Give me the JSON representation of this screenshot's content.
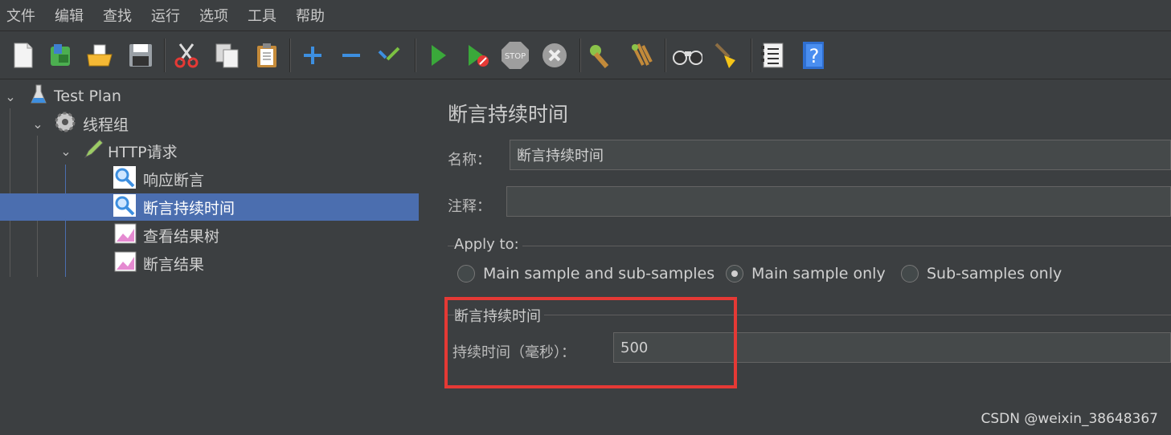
{
  "menu": [
    "文件",
    "编辑",
    "查找",
    "运行",
    "选项",
    "工具",
    "帮助"
  ],
  "toolbar_icons": [
    "new-icon",
    "templates-icon",
    "open-icon",
    "save-icon",
    "cut-icon",
    "copy-icon",
    "paste-icon",
    "expand-icon",
    "collapse-icon",
    "toggle-icon",
    "start-icon",
    "start-no-pause-icon",
    "stop-icon",
    "shutdown-icon",
    "clear-icon",
    "clear-all-icon",
    "search-icon",
    "reset-search-icon",
    "function-helper-icon",
    "help-icon"
  ],
  "tree": {
    "items": [
      {
        "label": "Test Plan",
        "icon": "test-plan-icon"
      },
      {
        "label": "线程组",
        "icon": "thread-group-gear-icon"
      },
      {
        "label": "HTTP请求",
        "icon": "http-sampler-pen-icon"
      },
      {
        "label": "响应断言",
        "icon": "assertion-magnifier-icon"
      },
      {
        "label": "断言持续时间",
        "icon": "assertion-magnifier-icon"
      },
      {
        "label": "查看结果树",
        "icon": "listener-chart-icon"
      },
      {
        "label": "断言结果",
        "icon": "listener-chart-icon"
      }
    ],
    "selected": "断言持续时间"
  },
  "panel": {
    "title": "断言持续时间",
    "name_label": "名称：",
    "name_value": "断言持续时间",
    "comment_label": "注释：",
    "comment_value": "",
    "apply_to": {
      "title": "Apply to:",
      "options": [
        "Main sample and sub-samples",
        "Main sample only",
        "Sub-samples only"
      ],
      "selected": "Main sample only"
    },
    "duration_group": {
      "title": "断言持续时间",
      "label": "持续时间（毫秒）：",
      "value": "500"
    }
  },
  "highlight_color": "#e53935",
  "watermark": "CSDN @weixin_38648367"
}
